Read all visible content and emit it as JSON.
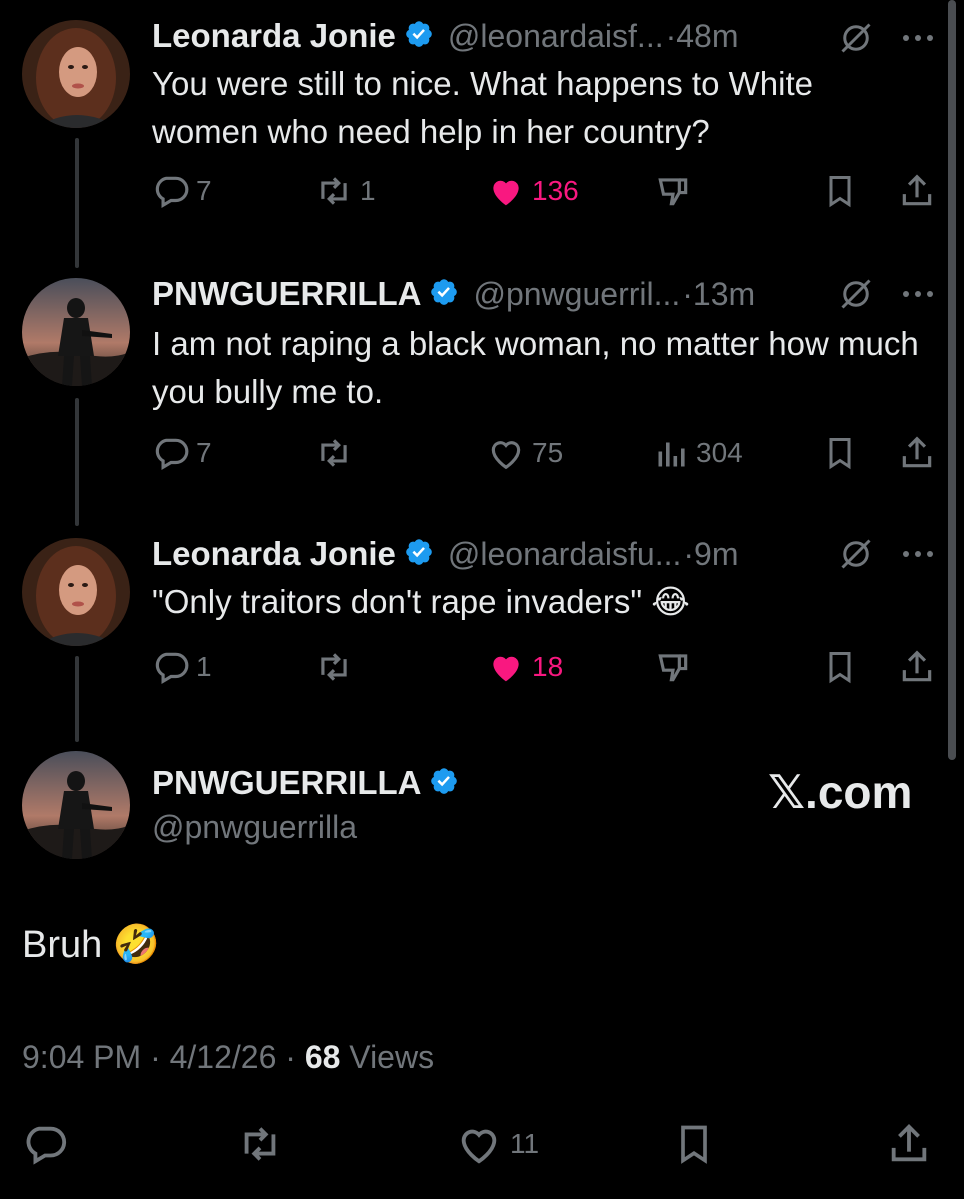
{
  "tweets": [
    {
      "name": "Leonarda Jonie",
      "handle": "@leonardaisf...",
      "time": "·48m",
      "text": "You were still to nice. What happens to White women who need help in her country?",
      "replies": "7",
      "reposts": "1",
      "likes": "136"
    },
    {
      "name": "PNWGUERRILLA",
      "handle": "@pnwguerril...",
      "time": "·13m",
      "text": "I am not raping a black woman, no matter how much you bully me to.",
      "replies": "7",
      "reposts": "",
      "likes": "75",
      "views": "304"
    },
    {
      "name": "Leonarda Jonie",
      "handle": "@leonardaisfu...",
      "time": "·9m",
      "text": "\"Only traitors don't rape invaders\" 😂",
      "replies": "1",
      "reposts": "",
      "likes": "18"
    }
  ],
  "main": {
    "name": "PNWGUERRILLA",
    "handle": "@pnwguerrilla",
    "text": "Bruh 🤣",
    "time": "9:04 PM · 4/12/26 · ",
    "views_count": "68",
    "views_label": " Views",
    "likes": "11",
    "watermark": "𝕏.com"
  },
  "colors": {
    "background": "#000000",
    "text": "#e7e9ea",
    "secondary": "#71767b",
    "like_pink": "#f91880",
    "verified_blue": "#1d9bf0"
  },
  "icons": [
    "reply-icon",
    "repost-icon",
    "heart-icon",
    "dislike-icon",
    "bookmark-icon",
    "share-icon",
    "grok-icon",
    "more-icon",
    "views-icon",
    "verified-badge-icon"
  ]
}
